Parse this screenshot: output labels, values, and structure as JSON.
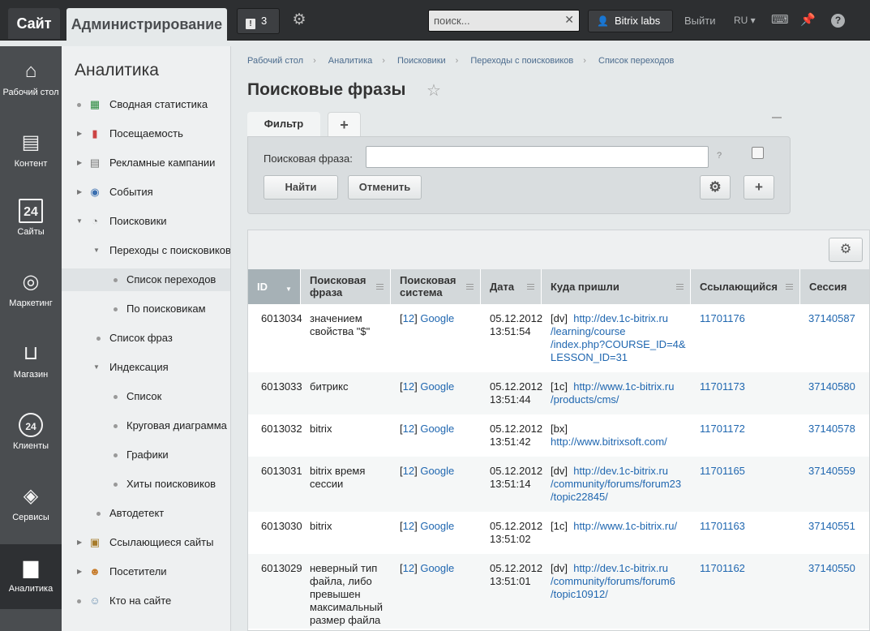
{
  "topbar": {
    "site_label": "Сайт",
    "admin_tab": "Администрирование",
    "notifications_count": "3",
    "search_placeholder": "поиск...",
    "user_name": "Bitrix labs",
    "logout_label": "Выйти",
    "lang": "RU"
  },
  "iconbar": [
    {
      "label": "Рабочий стол",
      "icon": "home-icon"
    },
    {
      "label": "Контент",
      "icon": "document-icon"
    },
    {
      "label": "Сайты",
      "icon": "calendar-24-icon"
    },
    {
      "label": "Маркетинг",
      "icon": "target-icon"
    },
    {
      "label": "Магазин",
      "icon": "basket-icon"
    },
    {
      "label": "Клиенты",
      "icon": "clients-24-icon"
    },
    {
      "label": "Сервисы",
      "icon": "layers-icon"
    },
    {
      "label": "Аналитика",
      "icon": "bar-chart-icon"
    }
  ],
  "menu": {
    "title": "Аналитика",
    "items": [
      {
        "label": "Сводная статистика"
      },
      {
        "label": "Посещаемость"
      },
      {
        "label": "Рекламные кампании"
      },
      {
        "label": "События"
      },
      {
        "label": "Поисковики"
      },
      {
        "label": "Переходы с поисковиков"
      },
      {
        "label": "Список переходов"
      },
      {
        "label": "По поисковикам"
      },
      {
        "label": "Список фраз"
      },
      {
        "label": "Индексация"
      },
      {
        "label": "Список"
      },
      {
        "label": "Круговая диаграмма"
      },
      {
        "label": "Графики"
      },
      {
        "label": "Хиты поисковиков"
      },
      {
        "label": "Автодетект"
      },
      {
        "label": "Ссылающиеся сайты"
      },
      {
        "label": "Посетители"
      },
      {
        "label": "Кто на сайте"
      }
    ]
  },
  "breadcrumbs": [
    "Рабочий стол",
    "Аналитика",
    "Поисковики",
    "Переходы с поисковиков",
    "Список переходов"
  ],
  "page_title": "Поисковые фразы",
  "filter": {
    "tab_label": "Фильтр",
    "add_tab": "+",
    "field_label": "Поисковая фраза:",
    "field_value": "",
    "help_mark": "?",
    "find_button": "Найти",
    "cancel_button": "Отменить"
  },
  "grid": {
    "columns": [
      "ID",
      "Поисковая фраза",
      "Поисковая система",
      "Дата",
      "Куда пришли",
      "Ссылающийся",
      "Сессия"
    ],
    "rows": [
      {
        "id": "6013034",
        "phrase": "значением свойства \"$\"",
        "engine_num": "12",
        "engine": "Google",
        "date": "05.12.2012",
        "time": "13:51:54",
        "site": "dv",
        "url": "http://dev.1c-bitrix.ru/learning/course/index.php?COURSE_ID=4&LESSON_ID=31",
        "referer": "11701176",
        "session": "37140587"
      },
      {
        "id": "6013033",
        "phrase": "битрикс",
        "engine_num": "12",
        "engine": "Google",
        "date": "05.12.2012",
        "time": "13:51:44",
        "site": "1c",
        "url": "http://www.1c-bitrix.ru/products/cms/",
        "referer": "11701173",
        "session": "37140580"
      },
      {
        "id": "6013032",
        "phrase": "bitrix",
        "engine_num": "12",
        "engine": "Google",
        "date": "05.12.2012",
        "time": "13:51:42",
        "site": "bx",
        "url": "http://www.bitrixsoft.com/",
        "referer": "11701172",
        "session": "37140578"
      },
      {
        "id": "6013031",
        "phrase": "bitrix время сессии",
        "engine_num": "12",
        "engine": "Google",
        "date": "05.12.2012",
        "time": "13:51:14",
        "site": "dv",
        "url": "http://dev.1c-bitrix.ru/community/forums/forum23/topic22845/",
        "referer": "11701165",
        "session": "37140559"
      },
      {
        "id": "6013030",
        "phrase": "bitrix",
        "engine_num": "12",
        "engine": "Google",
        "date": "05.12.2012",
        "time": "13:51:02",
        "site": "1c",
        "url": "http://www.1c-bitrix.ru/",
        "referer": "11701163",
        "session": "37140551"
      },
      {
        "id": "6013029",
        "phrase": "неверный тип файла, либо превышен максимальный размер файла",
        "engine_num": "12",
        "engine": "Google",
        "date": "05.12.2012",
        "time": "13:51:01",
        "site": "dv",
        "url": "http://dev.1c-bitrix.ru/community/forums/forum6/topic10912/",
        "referer": "11701162",
        "session": "37140550"
      }
    ]
  }
}
